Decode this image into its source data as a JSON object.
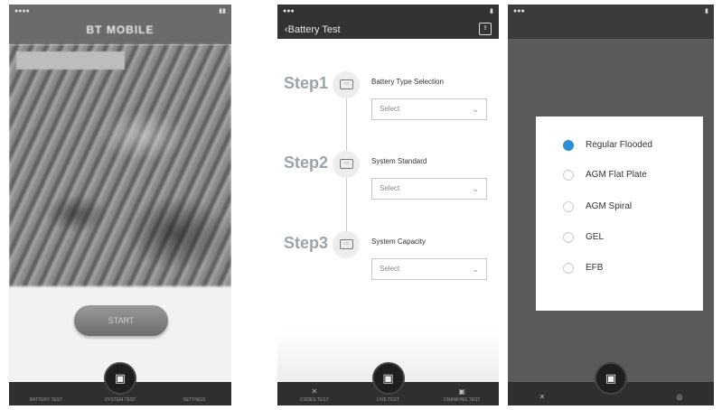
{
  "phone1": {
    "brand": "BT MOBILE",
    "start_label": "START",
    "tabs": [
      "BATTERY TEST",
      "SYSTEM TEST",
      "SETTINGS"
    ]
  },
  "phone2": {
    "header": {
      "back_label": "Battery Test"
    },
    "steps": [
      {
        "label": "Step1",
        "title": "Battery Type Selection",
        "select": "Select"
      },
      {
        "label": "Step2",
        "title": "System Standard",
        "select": "Select"
      },
      {
        "label": "Step3",
        "title": "System Capacity",
        "select": "Select"
      }
    ],
    "tabs": [
      "CODES TEST",
      "LIVE TEST",
      "CRANKING TEST"
    ]
  },
  "phone3": {
    "options": [
      {
        "label": "Regular Flooded",
        "selected": true
      },
      {
        "label": "AGM Flat Plate",
        "selected": false
      },
      {
        "label": "AGM Spiral",
        "selected": false
      },
      {
        "label": "GEL",
        "selected": false
      },
      {
        "label": "EFB",
        "selected": false
      }
    ],
    "accent_color": "#2c8fd6"
  }
}
